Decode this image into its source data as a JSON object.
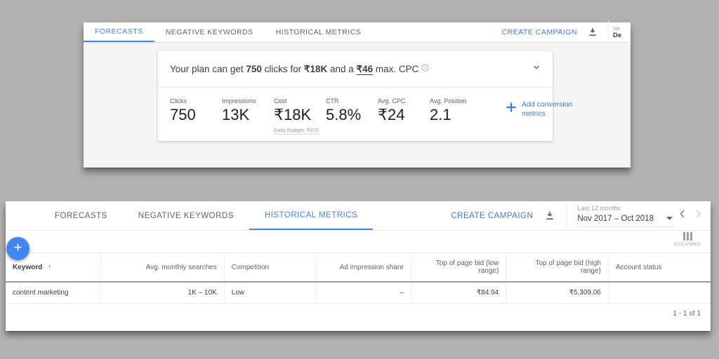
{
  "top_panel": {
    "tabs": [
      {
        "label": "FORECASTS",
        "active": true
      },
      {
        "label": "NEGATIVE KEYWORDS",
        "active": false
      },
      {
        "label": "HISTORICAL METRICS",
        "active": false
      }
    ],
    "create_campaign_label": "CREATE CAMPAIGN",
    "download_icon": "download-icon",
    "date_range": {
      "small_label": "Ne",
      "value": "De"
    },
    "forecast_card": {
      "headline_prefix": "Your plan can get ",
      "clicks_value": "750",
      "headline_mid": " clicks for ",
      "cost_value": "₹18K",
      "headline_mid2": " and a ",
      "cpc_value": "₹46",
      "headline_suffix": " max. CPC",
      "help_icon": "help-icon",
      "collapse_icon": "chevron-down-icon",
      "metrics": [
        {
          "label": "Clicks",
          "value": "750",
          "sub": ""
        },
        {
          "label": "Impressions",
          "value": "13K",
          "sub": ""
        },
        {
          "label": "Cost",
          "value": "₹18K",
          "sub": "Daily Budget: ₹670"
        },
        {
          "label": "CTR",
          "value": "5.8%",
          "sub": ""
        },
        {
          "label": "Avg. CPC",
          "value": "₹24",
          "sub": ""
        },
        {
          "label": "Avg. Position",
          "value": "2.1",
          "sub": ""
        }
      ],
      "add_conversion_label": "Add conversion metrics",
      "add_icon": "plus-icon"
    }
  },
  "bottom_panel": {
    "tabs": [
      {
        "label": "FORECASTS",
        "active": false
      },
      {
        "label": "NEGATIVE KEYWORDS",
        "active": false
      },
      {
        "label": "HISTORICAL METRICS",
        "active": true
      }
    ],
    "create_campaign_label": "CREATE CAMPAIGN",
    "download_icon": "download-icon",
    "date_range": {
      "small_label": "Last 12 months",
      "value": "Nov 2017 – Oct 2018",
      "dropdown_icon": "caret-down-icon",
      "prev_icon": "chevron-left-icon",
      "next_icon": "chevron-right-icon"
    },
    "add_fab": {
      "icon": "plus-icon"
    },
    "columns_button": {
      "label": "COLUMNS",
      "icon": "columns-icon"
    },
    "table": {
      "columns": [
        {
          "label": "Keyword",
          "align": "left",
          "sorted": true,
          "sort_icon": "↑"
        },
        {
          "label": "Avg. monthly searches",
          "align": "right"
        },
        {
          "label": "Competition",
          "align": "left"
        },
        {
          "label": "Ad impression share",
          "align": "right"
        },
        {
          "label": "Top of page bid (low range)",
          "align": "right"
        },
        {
          "label": "Top of page bid (high range)",
          "align": "right"
        },
        {
          "label": "Account status",
          "align": "left"
        }
      ],
      "rows": [
        {
          "keyword": "content marketing",
          "avg_monthly_searches": "1K – 10K",
          "competition": "Low",
          "ad_impression_share": "–",
          "top_bid_low": "₹84.94",
          "top_bid_high": "₹5,309.06",
          "account_status": ""
        }
      ]
    },
    "pagination": "1 - 1 of 1"
  },
  "colors": {
    "accent_blue": "#4285f4",
    "link_blue": "#3f7ae0",
    "page_background": "#b2b2b2",
    "card_background": "#f4f4f4"
  }
}
